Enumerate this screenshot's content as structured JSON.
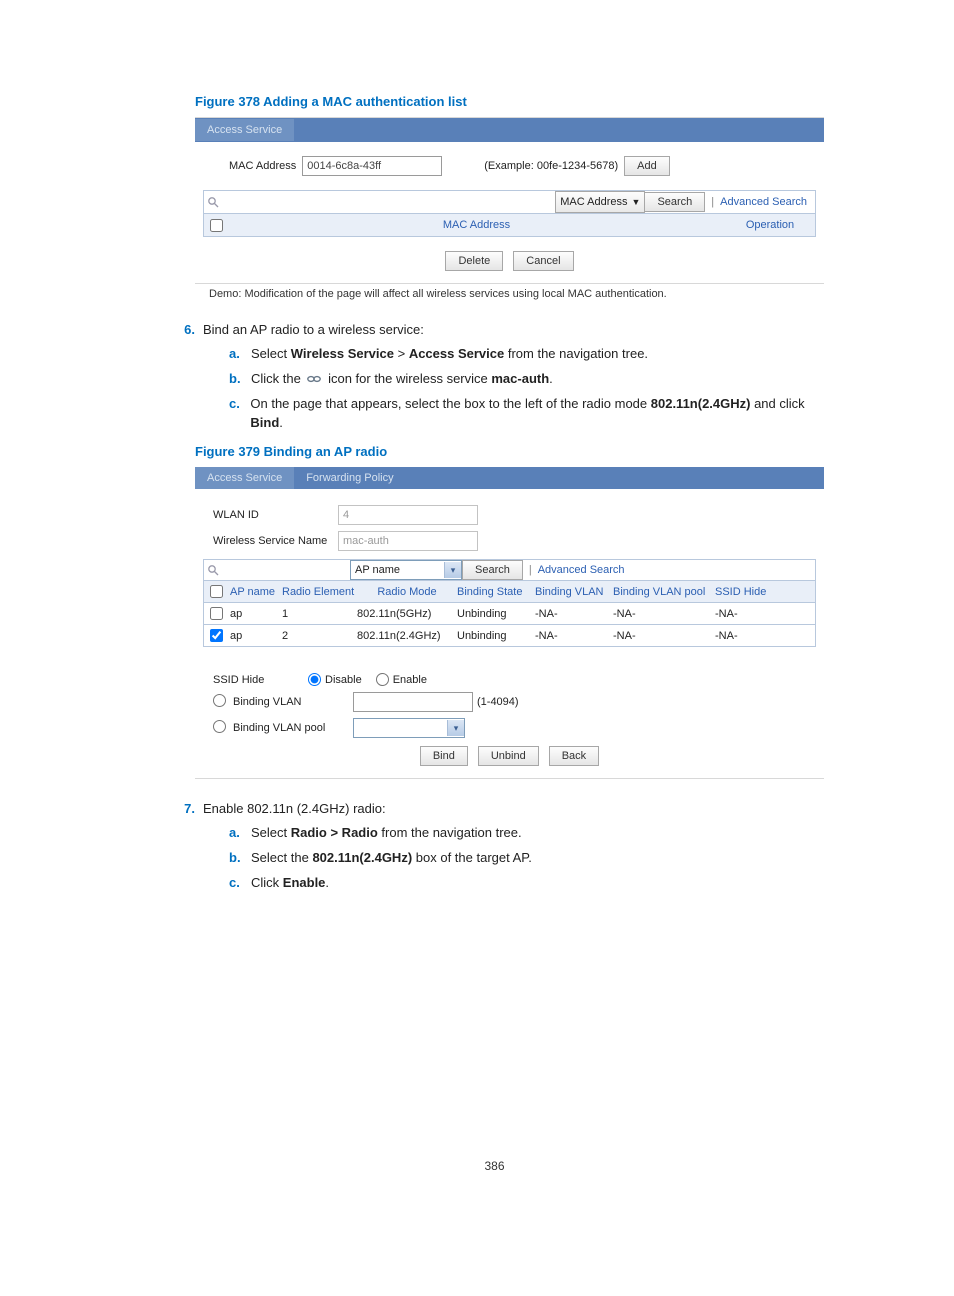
{
  "fig378": {
    "caption": "Figure 378 Adding a MAC authentication list",
    "tab": "Access Service",
    "mac_label": "MAC Address",
    "mac_value": "0014-6c8a-43ff",
    "example": "(Example: 00fe-1234-5678)",
    "add_btn": "Add",
    "search_by": "MAC Address",
    "search_btn": "Search",
    "adv_search": "Advanced Search",
    "col_mac": "MAC Address",
    "col_op": "Operation",
    "delete_btn": "Delete",
    "cancel_btn": "Cancel",
    "demo_note": "Demo: Modification of the page will affect all wireless services using local MAC authentication."
  },
  "step6": {
    "num": "6.",
    "text": "Bind an AP radio to a wireless service:",
    "a": {
      "lbl": "a.",
      "pre": "Select ",
      "b1": "Wireless Service",
      "mid": " > ",
      "b2": "Access Service",
      "post": " from the navigation tree."
    },
    "b": {
      "lbl": "b.",
      "pre": "Click the ",
      "post_icon": " icon for the wireless service ",
      "b1": "mac-auth",
      "end": "."
    },
    "c": {
      "lbl": "c.",
      "pre": "On the page that appears, select the box to the left of the radio mode ",
      "b1": "802.11n(2.4GHz)",
      "mid": " and click ",
      "b2": "Bind",
      "end": "."
    }
  },
  "fig379": {
    "caption": "Figure 379 Binding an AP radio",
    "tab1": "Access Service",
    "tab2": "Forwarding Policy",
    "wlan_id_lbl": "WLAN ID",
    "wlan_id": "4",
    "ws_name_lbl": "Wireless Service Name",
    "ws_name": "mac-auth",
    "search_by": "AP name",
    "search_btn": "Search",
    "adv_search": "Advanced Search",
    "cols": [
      "AP name",
      "Radio Element",
      "Radio Mode",
      "Binding State",
      "Binding VLAN",
      "Binding VLAN pool",
      "SSID Hide"
    ],
    "rows": [
      {
        "checked": false,
        "ap": "ap",
        "re": "1",
        "mode": "802.11n(5GHz)",
        "state": "Unbinding",
        "bv": "-NA-",
        "bvp": "-NA-",
        "hide": "-NA-"
      },
      {
        "checked": true,
        "ap": "ap",
        "re": "2",
        "mode": "802.11n(2.4GHz)",
        "state": "Unbinding",
        "bv": "-NA-",
        "bvp": "-NA-",
        "hide": "-NA-"
      }
    ],
    "ssid_hide_lbl": "SSID Hide",
    "disable": "Disable",
    "enable": "Enable",
    "binding_vlan": "Binding VLAN",
    "binding_vlan_range": "(1-4094)",
    "binding_vlan_pool": "Binding VLAN pool",
    "bind_btn": "Bind",
    "unbind_btn": "Unbind",
    "back_btn": "Back"
  },
  "step7": {
    "num": "7.",
    "text": "Enable 802.11n (2.4GHz) radio:",
    "a": {
      "lbl": "a.",
      "pre": "Select ",
      "b1": "Radio > Radio",
      "post": " from the navigation tree."
    },
    "b": {
      "lbl": "b.",
      "pre": "Select the ",
      "b1": "802.11n(2.4GHz)",
      "post": " box of the target AP."
    },
    "c": {
      "lbl": "c.",
      "pre": "Click ",
      "b1": "Enable",
      "post": "."
    }
  },
  "page_num": "386"
}
